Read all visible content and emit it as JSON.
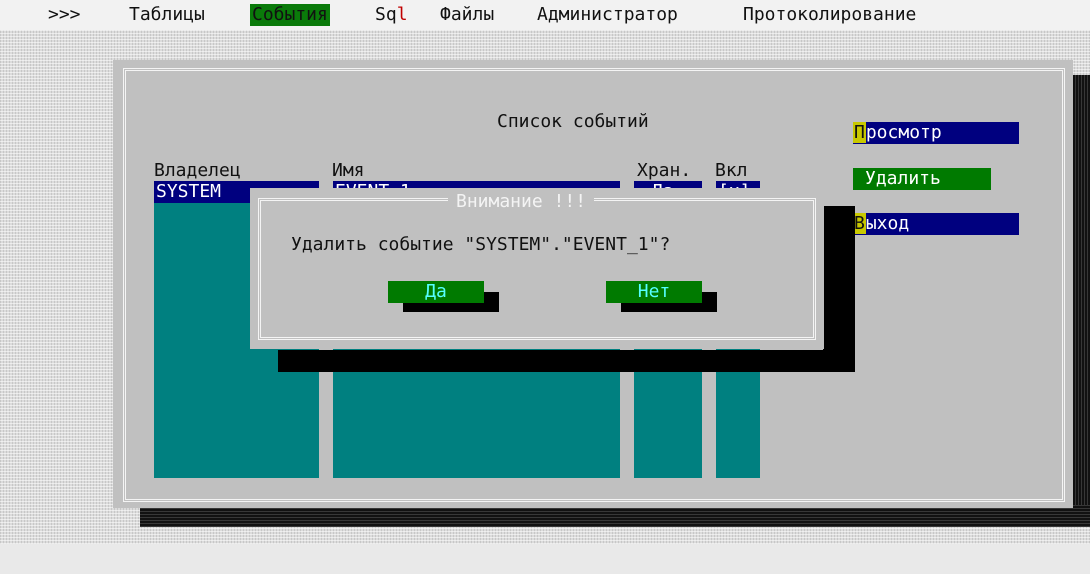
{
  "menu": {
    "prefix": ">>>",
    "items": [
      "Таблицы",
      "События",
      "Sql",
      "Файлы",
      "Администратор",
      "Протоколирование"
    ],
    "sql_parts": [
      "Sq",
      "l"
    ],
    "active": "События"
  },
  "window": {
    "title": "Список событий",
    "columns": [
      "Владелец",
      "Имя",
      "Хран.",
      "Вкл"
    ],
    "row": {
      "owner": "SYSTEM",
      "name": "EVENT_1",
      "stored": "Да",
      "enabled": "[x]"
    },
    "buttons": {
      "view": {
        "hotkey": "П",
        "rest": "росмотр"
      },
      "delete": "Удалить",
      "exit": {
        "hotkey": "В",
        "rest": "ыход"
      }
    }
  },
  "dialog": {
    "title": "Внимание !!!",
    "message": "Удалить событие \"SYSTEM\".\"EVENT_1\"?",
    "yes": "Да",
    "no": "Нет"
  },
  "colors": {
    "teal": "#008080",
    "navy": "#00007f",
    "green": "#007a00",
    "gray": "#c0c0c0",
    "hotkey_yellow": "#c8c800"
  }
}
